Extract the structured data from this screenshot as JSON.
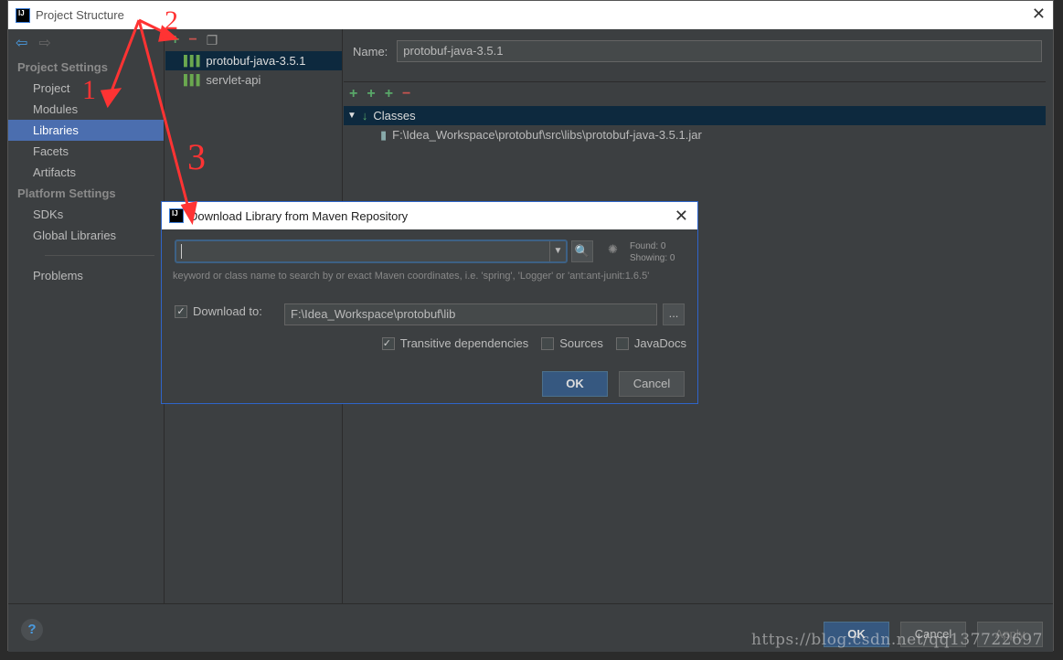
{
  "window": {
    "title": "Project Structure",
    "logo": "IJ"
  },
  "sidebar": {
    "sections": [
      {
        "title": "Project Settings",
        "items": [
          "Project",
          "Modules",
          "Libraries",
          "Facets",
          "Artifacts"
        ]
      },
      {
        "title": "Platform Settings",
        "items": [
          "SDKs",
          "Global Libraries"
        ]
      }
    ],
    "problems": "Problems",
    "selected": "Libraries"
  },
  "libraries": [
    "protobuf-java-3.5.1",
    "servlet-api"
  ],
  "detail": {
    "name_label": "Name:",
    "name_value": "protobuf-java-3.5.1",
    "classes_label": "Classes",
    "jar_path": "F:\\Idea_Workspace\\protobuf\\src\\libs\\protobuf-java-3.5.1.jar"
  },
  "footer": {
    "ok": "OK",
    "cancel": "Cancel",
    "apply": "Apply",
    "help": "?"
  },
  "dialog": {
    "title": "Download Library from Maven Repository",
    "logo": "IJ",
    "search_value": "",
    "found": "Found: 0",
    "showing": "Showing: 0",
    "hint": "keyword or class name to search by or exact Maven coordinates, i.e. 'spring', 'Logger' or 'ant:ant-junit:1.6.5'",
    "download_to_label": "Download to:",
    "download_to_checked": true,
    "download_path": "F:\\Idea_Workspace\\protobuf\\lib",
    "browse": "...",
    "transitive": "Transitive dependencies",
    "transitive_checked": true,
    "sources": "Sources",
    "sources_checked": false,
    "javadocs": "JavaDocs",
    "javadocs_checked": false,
    "ok": "OK",
    "cancel": "Cancel"
  },
  "annotations": [
    "1",
    "2",
    "3"
  ],
  "watermark": "https://blog.csdn.net/qq137722697",
  "colors": {
    "selection": "#4b6eaf",
    "annotation": "#ff3333",
    "ok_button": "#365880"
  }
}
